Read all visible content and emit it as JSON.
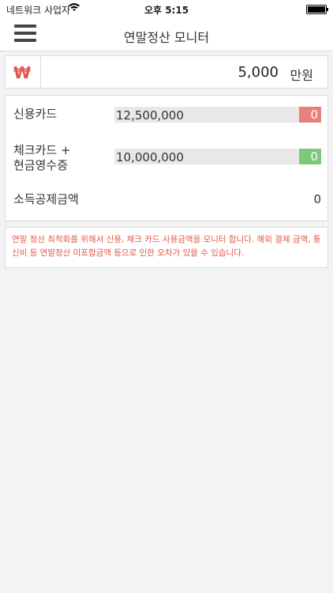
{
  "status_bar": {
    "carrier": "네트워크 사업자",
    "time": "오후 5:15",
    "wifi_icon": "wifi-icon",
    "battery_icon": "battery-icon"
  },
  "nav": {
    "title": "연말정산 모니터",
    "menu_icon": "hamburger-menu-icon"
  },
  "amount": {
    "currency_symbol": "₩",
    "value": "5,000",
    "unit": "만원"
  },
  "rows": {
    "credit": {
      "label": "신용카드",
      "amount": "12,500,000",
      "tag": "0",
      "tag_color": "#e8807a"
    },
    "check": {
      "label_line1": "체크카드 +",
      "label_line2": "현금영수증",
      "amount": "10,000,000",
      "tag": "0",
      "tag_color": "#7cc97a"
    },
    "deduction": {
      "label": "소득공제금액",
      "value": "0"
    }
  },
  "notice": "연말 정산 최적화를 위해서 신용, 체크 카드 사용금액을 모니터 합니다. 해외 결제 금액, 통신비 등 연말정산 미포함금액 등으로 인한 오차가 있을 수 있습니다.",
  "colors": {
    "accent": "#e0574b",
    "background": "#f3f3f3"
  }
}
